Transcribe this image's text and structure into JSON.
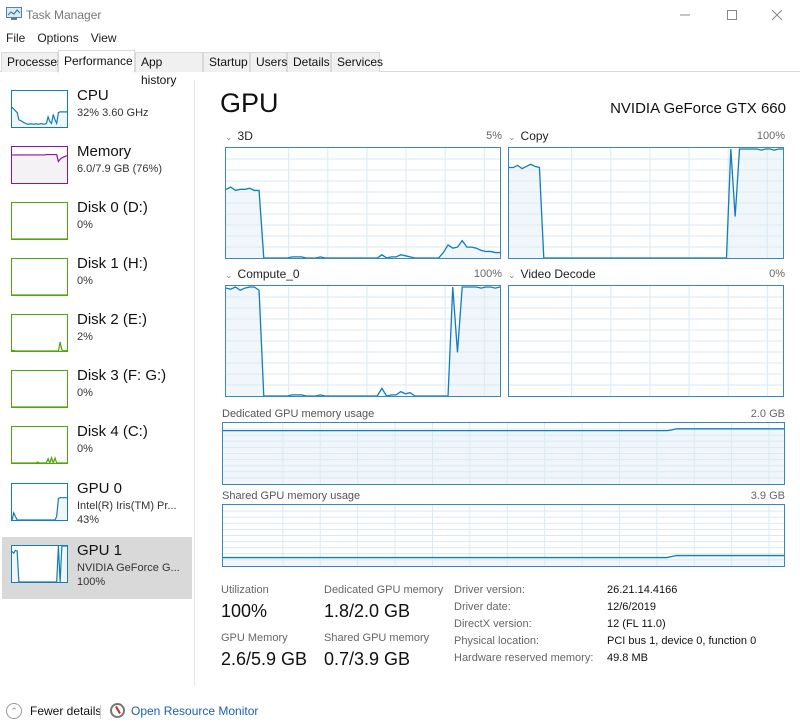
{
  "window": {
    "title": "Task Manager",
    "minimize_icon": "minimize-icon",
    "maximize_icon": "maximize-icon",
    "close_icon": "close-icon"
  },
  "menu": [
    "File",
    "Options",
    "View"
  ],
  "tabs": [
    {
      "label": "Processes",
      "active": false
    },
    {
      "label": "Performance",
      "active": true
    },
    {
      "label": "App history",
      "active": false
    },
    {
      "label": "Startup",
      "active": false
    },
    {
      "label": "Users",
      "active": false
    },
    {
      "label": "Details",
      "active": false
    },
    {
      "label": "Services",
      "active": false
    }
  ],
  "sidebar": {
    "items": [
      {
        "title": "CPU",
        "sub1": "32% 3.60 GHz",
        "sub2": "",
        "color": "#117dbb",
        "fill": "#f1f6fa",
        "series": [
          55,
          50,
          45,
          40,
          20,
          18,
          15,
          12,
          10,
          8,
          8,
          9,
          8,
          8,
          9,
          8,
          8,
          10,
          8,
          8,
          10,
          28,
          15,
          10,
          35,
          20,
          10,
          40,
          42,
          42,
          42,
          42,
          42
        ]
      },
      {
        "title": "Memory",
        "sub1": "6.0/7.9 GB (76%)",
        "sub2": "",
        "color": "#8b12ae",
        "fill": "#f4f2f4",
        "series": [
          78,
          78,
          78,
          78,
          78,
          78,
          78,
          78,
          78,
          78,
          78,
          78,
          78,
          78,
          78,
          78,
          78,
          78,
          78,
          78,
          79,
          79,
          79,
          79,
          79,
          79,
          79,
          60,
          66,
          70,
          72,
          74,
          76
        ]
      },
      {
        "title": "Disk 0 (D:)",
        "sub1": "0%",
        "sub2": "",
        "color": "#4da60c",
        "fill": "#eff7ea",
        "series": [
          0,
          0,
          0,
          0,
          0,
          0,
          0,
          0,
          0,
          0
        ]
      },
      {
        "title": "Disk 1 (H:)",
        "sub1": "0%",
        "sub2": "",
        "color": "#4da60c",
        "fill": "#eff7ea",
        "series": [
          0,
          0,
          0,
          0,
          0,
          0,
          0,
          0,
          0,
          0
        ]
      },
      {
        "title": "Disk 2 (E:)",
        "sub1": "2%",
        "sub2": "",
        "color": "#4da60c",
        "fill": "#eff7ea",
        "series": [
          2,
          1,
          0,
          0,
          0,
          0,
          0,
          0,
          0,
          0,
          0,
          0,
          0,
          0,
          0,
          0,
          0,
          0,
          0,
          0,
          0,
          0,
          0,
          0,
          0,
          0,
          0,
          0,
          25,
          3,
          0,
          1,
          2
        ]
      },
      {
        "title": "Disk 3 (F: G:)",
        "sub1": "0%",
        "sub2": "",
        "color": "#4da60c",
        "fill": "#eff7ea",
        "series": [
          0,
          0,
          0,
          0,
          0,
          0,
          0,
          0,
          0,
          0
        ]
      },
      {
        "title": "Disk 4 (C:)",
        "sub1": "0%",
        "sub2": "",
        "color": "#4da60c",
        "fill": "#eff7ea",
        "series": [
          0,
          0,
          0,
          0,
          0,
          0,
          0,
          0,
          0,
          0,
          0,
          0,
          0,
          0,
          0,
          3,
          0,
          0,
          0,
          0,
          0,
          12,
          0,
          15,
          0,
          14,
          0,
          0,
          0,
          0,
          0,
          0,
          0
        ]
      },
      {
        "title": "GPU 0",
        "sub1": "Intel(R) Iris(TM) Pr...",
        "sub2": "43%",
        "color": "#117dbb",
        "fill": "#f1f6fa",
        "series": [
          0,
          20,
          10,
          0,
          0,
          0,
          0,
          0,
          0,
          0,
          0,
          0,
          0,
          0,
          0,
          0,
          0,
          0,
          0,
          0,
          0,
          0,
          0,
          0,
          0,
          0,
          10,
          60,
          62,
          62,
          62,
          62,
          62
        ]
      },
      {
        "title": "GPU 1",
        "sub1": "NVIDIA GeForce G...",
        "sub2": "100%",
        "color": "#117dbb",
        "fill": "#f1f6fa",
        "selected": true,
        "series": [
          85,
          80,
          88,
          86,
          0,
          0,
          0,
          0,
          0,
          0,
          0,
          0,
          0,
          0,
          0,
          0,
          0,
          0,
          0,
          0,
          0,
          0,
          0,
          0,
          0,
          0,
          0,
          100,
          0,
          100,
          100,
          100,
          100
        ]
      }
    ]
  },
  "main": {
    "title": "GPU",
    "device_name": "NVIDIA GeForce GTX 660",
    "collapse_icon": "chevron-down-icon"
  },
  "chart_data": [
    {
      "type": "area",
      "title": "3D",
      "max_label": "5%",
      "ylim": [
        0,
        100
      ],
      "grid": true,
      "values": [
        63,
        65,
        62,
        63,
        63,
        64,
        62,
        62,
        0,
        0,
        0,
        0,
        0,
        0,
        1,
        1,
        1,
        0,
        0,
        0,
        1,
        0,
        0,
        0,
        0,
        0,
        0,
        0,
        0,
        0,
        0,
        0,
        0,
        3,
        0,
        1,
        1,
        3,
        2,
        1,
        0,
        0,
        0,
        0,
        0,
        0,
        5,
        12,
        9,
        10,
        16,
        10,
        10,
        9,
        7,
        6,
        6,
        5,
        5
      ]
    },
    {
      "type": "area",
      "title": "Copy",
      "max_label": "100%",
      "ylim": [
        0,
        100
      ],
      "grid": true,
      "values": [
        83,
        83,
        85,
        82,
        84,
        86,
        84,
        83,
        0,
        0,
        0,
        0,
        0,
        0,
        0,
        0,
        0,
        0,
        0,
        0,
        0,
        0,
        0,
        0,
        0,
        0,
        0,
        0,
        0,
        0,
        0,
        0,
        0,
        0,
        0,
        0,
        0,
        0,
        0,
        0,
        0,
        0,
        0,
        0,
        0,
        0,
        0,
        0,
        0,
        0,
        0,
        100,
        38,
        100,
        100,
        100,
        100,
        100,
        99,
        100,
        100,
        99,
        100,
        100
      ]
    },
    {
      "type": "area",
      "title": "Compute_0",
      "max_label": "100%",
      "ylim": [
        0,
        100
      ],
      "grid": true,
      "values": [
        99,
        98,
        100,
        97,
        99,
        100,
        100,
        97,
        0,
        0,
        0,
        0,
        0,
        0,
        1,
        1,
        1,
        0,
        0,
        0,
        1,
        0,
        0,
        0,
        0,
        0,
        0,
        0,
        0,
        0,
        0,
        0,
        0,
        7,
        0,
        1,
        1,
        4,
        2,
        3,
        0,
        0,
        0,
        0,
        0,
        0,
        0,
        0,
        100,
        40,
        100,
        100,
        100,
        100,
        99,
        100,
        100,
        99,
        100
      ]
    },
    {
      "type": "area",
      "title": "Video Decode",
      "max_label": "0%",
      "ylim": [
        0,
        100
      ],
      "grid": true,
      "values": []
    },
    {
      "type": "area",
      "title": "Dedicated GPU memory usage",
      "max_label": "2.0 GB",
      "ylim": [
        0,
        2.0
      ],
      "grid": true,
      "values": [
        1.78,
        1.78,
        1.78,
        1.78,
        1.78,
        1.78,
        1.78,
        1.78,
        1.78,
        1.78,
        1.78,
        1.78,
        1.78,
        1.78,
        1.78,
        1.78,
        1.78,
        1.78,
        1.78,
        1.78,
        1.78,
        1.78,
        1.78,
        1.78,
        1.78,
        1.78,
        1.78,
        1.78,
        1.78,
        1.78,
        1.78,
        1.78,
        1.78,
        1.78,
        1.78,
        1.78,
        1.78,
        1.78,
        1.78,
        1.78,
        1.78,
        1.78,
        1.78,
        1.78,
        1.78,
        1.78,
        1.78,
        1.78,
        1.78,
        1.78,
        1.78,
        1.78,
        1.78,
        1.78,
        1.78,
        1.78,
        1.78,
        1.78,
        1.78,
        1.78,
        1.78,
        1.78,
        1.78,
        1.78,
        1.78,
        1.78,
        1.78,
        1.78,
        1.78,
        1.78,
        1.78,
        1.78,
        1.78,
        1.78,
        1.78,
        1.78,
        1.78,
        1.78,
        1.78,
        1.78,
        1.78,
        1.78,
        1.78,
        1.78,
        1.78,
        1.78,
        1.78,
        1.78,
        1.78,
        1.78,
        1.78,
        1.78,
        1.78,
        1.78,
        1.78,
        1.78,
        1.8,
        1.84,
        1.84,
        1.84,
        1.84,
        1.84,
        1.84,
        1.84,
        1.84,
        1.84,
        1.84,
        1.84,
        1.84,
        1.84,
        1.84,
        1.84,
        1.84,
        1.84,
        1.84,
        1.84,
        1.84,
        1.84,
        1.84,
        1.84,
        1.84
      ]
    },
    {
      "type": "area",
      "title": "Shared GPU memory usage",
      "max_label": "3.9 GB",
      "ylim": [
        0,
        3.9
      ],
      "grid": true,
      "values": [
        0.55,
        0.55,
        0.55,
        0.55,
        0.55,
        0.55,
        0.55,
        0.55,
        0.55,
        0.55,
        0.55,
        0.55,
        0.55,
        0.55,
        0.55,
        0.55,
        0.55,
        0.55,
        0.55,
        0.55,
        0.55,
        0.55,
        0.55,
        0.55,
        0.55,
        0.55,
        0.55,
        0.55,
        0.55,
        0.55,
        0.55,
        0.55,
        0.55,
        0.55,
        0.55,
        0.55,
        0.55,
        0.55,
        0.55,
        0.55,
        0.55,
        0.55,
        0.55,
        0.55,
        0.55,
        0.55,
        0.55,
        0.55,
        0.55,
        0.55,
        0.55,
        0.55,
        0.55,
        0.55,
        0.55,
        0.55,
        0.55,
        0.55,
        0.55,
        0.55,
        0.55,
        0.55,
        0.55,
        0.55,
        0.55,
        0.55,
        0.55,
        0.55,
        0.55,
        0.55,
        0.55,
        0.55,
        0.55,
        0.55,
        0.55,
        0.55,
        0.55,
        0.55,
        0.55,
        0.55,
        0.55,
        0.55,
        0.55,
        0.55,
        0.55,
        0.55,
        0.55,
        0.55,
        0.55,
        0.55,
        0.55,
        0.55,
        0.55,
        0.55,
        0.55,
        0.55,
        0.62,
        0.68,
        0.68,
        0.68,
        0.68,
        0.68,
        0.68,
        0.68,
        0.68,
        0.68,
        0.68,
        0.68,
        0.68,
        0.68,
        0.68,
        0.68,
        0.68,
        0.68,
        0.68,
        0.68,
        0.68,
        0.68,
        0.68,
        0.68,
        0.68
      ]
    }
  ],
  "stats": {
    "utilization_label": "Utilization",
    "utilization_value": "100%",
    "dedicated_label": "Dedicated GPU memory",
    "dedicated_value": "1.8/2.0 GB",
    "gpu_memory_label": "GPU Memory",
    "gpu_memory_value": "2.6/5.9 GB",
    "shared_label": "Shared GPU memory",
    "shared_value": "0.7/3.9 GB"
  },
  "info": [
    {
      "label": "Driver version:",
      "value": "26.21.14.4166"
    },
    {
      "label": "Driver date:",
      "value": "12/6/2019"
    },
    {
      "label": "DirectX version:",
      "value": "12 (FL 11.0)"
    },
    {
      "label": "Physical location:",
      "value": "PCI bus 1, device 0, function 0"
    },
    {
      "label": "Hardware reserved memory:",
      "value": "49.8 MB"
    }
  ],
  "footer": {
    "fewer_details": "Fewer details",
    "resource_monitor": "Open Resource Monitor"
  },
  "colors": {
    "gpu_line": "#117dbb",
    "gpu_fill": "#f1f6fa",
    "grid": "#d9eaf4",
    "link": "#1a5fb4"
  }
}
